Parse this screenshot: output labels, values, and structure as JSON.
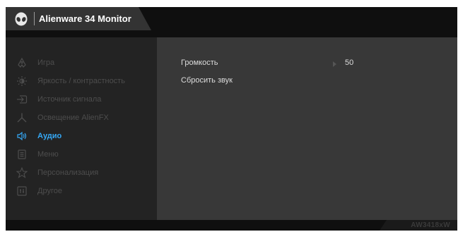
{
  "header": {
    "logo_icon": "alien-head-icon",
    "title": "Alienware 34 Monitor"
  },
  "sidebar": {
    "items": [
      {
        "icon": "gamepad-icon",
        "label": "Игра",
        "active": false
      },
      {
        "icon": "brightness-icon",
        "label": "Яркость / контрастность",
        "active": false
      },
      {
        "icon": "input-source-icon",
        "label": "Источник сигнала",
        "active": false
      },
      {
        "icon": "alienfx-icon",
        "label": "Освещение AlienFX",
        "active": false
      },
      {
        "icon": "speaker-icon",
        "label": "Аудио",
        "active": true
      },
      {
        "icon": "menu-icon",
        "label": "Меню",
        "active": false
      },
      {
        "icon": "star-icon",
        "label": "Персонализация",
        "active": false
      },
      {
        "icon": "other-icon",
        "label": "Другое",
        "active": false
      }
    ]
  },
  "content": {
    "volume": {
      "label": "Громкость",
      "value": "50"
    },
    "reset": {
      "label": "Сбросить звук"
    }
  },
  "footer": {
    "model": "AW3418xW"
  },
  "colors": {
    "accent": "#35a8f5",
    "inactive_text": "#4d4d4d",
    "panel": "#383838"
  }
}
